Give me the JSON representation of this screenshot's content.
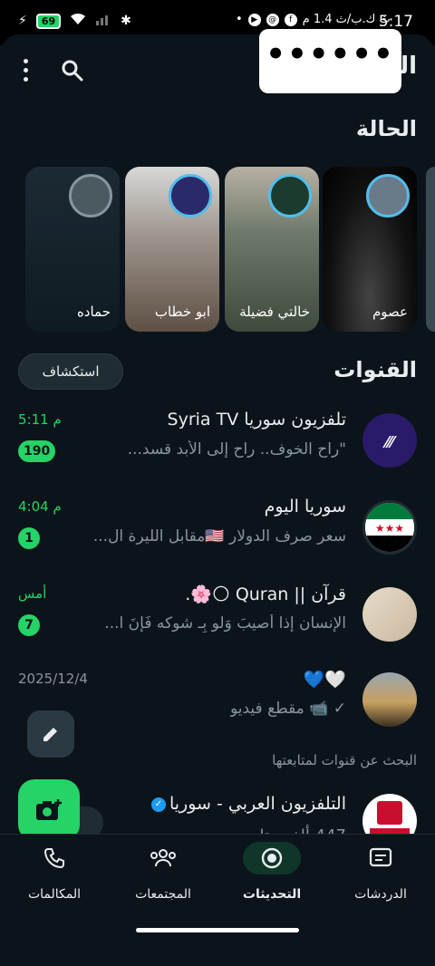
{
  "status_bar": {
    "time": "5:17",
    "battery": "69",
    "extra": "ث ك.ب/ث 1.4 م"
  },
  "app": {
    "title": "الت",
    "masked_text": "••••••"
  },
  "status_section": {
    "title": "الحالة",
    "items": [
      {
        "name": "عصوم"
      },
      {
        "name": "خالتي فضيلة"
      },
      {
        "name": "ابو خطاب"
      },
      {
        "name": "حماده"
      }
    ]
  },
  "channels_section": {
    "title": "القنوات",
    "explore_label": "استكشاف",
    "channels": [
      {
        "name": "تلفزيون سوريا Syria TV",
        "message": "\"راح الخوف.. راح إلى الأبد قسد...",
        "time": "5:11 م",
        "badge": "190"
      },
      {
        "name": "سوريا اليوم",
        "message": "سعر صرف الدولار 🇺🇸مقابل الليرة ال...",
        "time": "4:04 م",
        "badge": "1"
      },
      {
        "name": "قرآن || Quran 🌕🌸.",
        "message": "الإنسان إذا أُصيبَ وَلو بِـ شوكه  فَإنَ ا...",
        "time": "أمس",
        "badge": "7"
      },
      {
        "name": "🤍💙",
        "message": "✓ 📹 مقطع فيديو",
        "time": "2025/12/4",
        "badge": ""
      }
    ],
    "find_label": "البحث عن قنوات لمتابعتها",
    "suggestion": {
      "name": "التلفزيون العربي - سوريا",
      "followers": "447 ألف متابع"
    }
  },
  "bottom_nav": {
    "items": [
      {
        "label": "الدردشات",
        "icon": "chats-icon"
      },
      {
        "label": "التحديثات",
        "icon": "updates-icon",
        "active": true
      },
      {
        "label": "المجتمعات",
        "icon": "communities-icon"
      },
      {
        "label": "المكالمات",
        "icon": "calls-icon"
      }
    ]
  },
  "colors": {
    "background": "#0b141a",
    "accent": "#25d366",
    "muted": "#8696a0"
  }
}
